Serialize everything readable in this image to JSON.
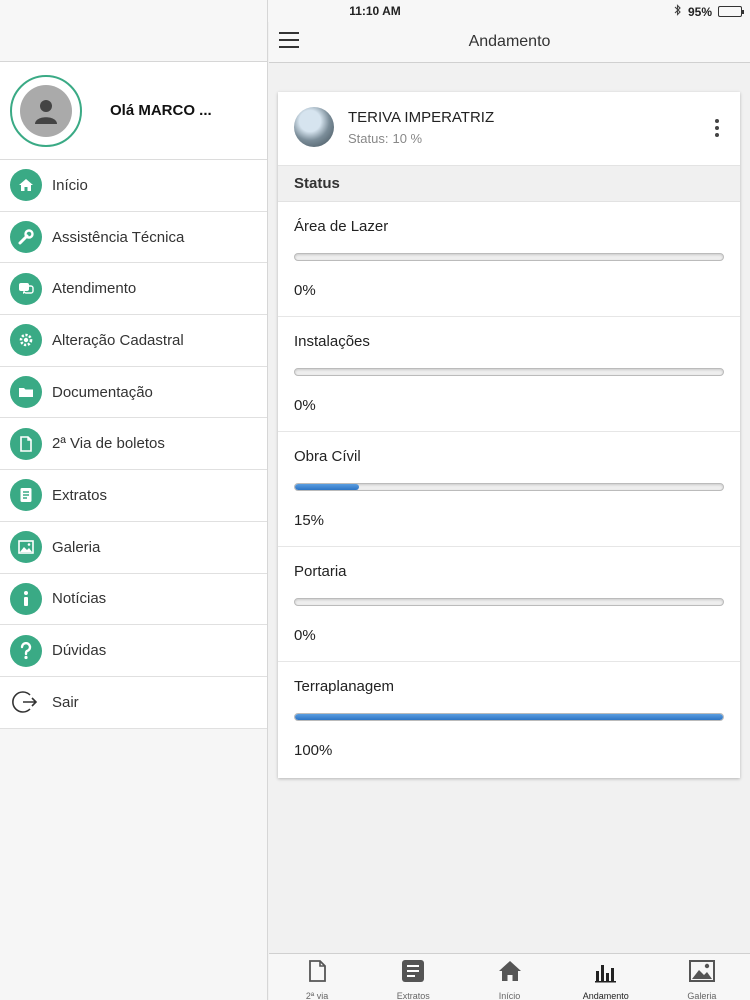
{
  "status_bar": {
    "device": "iPad",
    "time": "11:10 AM",
    "battery": "95%",
    "battery_level": 0.95
  },
  "header": {
    "title": "Andamento"
  },
  "sidebar": {
    "greeting": "Olá MARCO ...",
    "items": [
      {
        "label": "Início",
        "icon": "home-icon"
      },
      {
        "label": "Assistência Técnica",
        "icon": "wrench-icon"
      },
      {
        "label": "Atendimento",
        "icon": "chat-icon"
      },
      {
        "label": "Alteração Cadastral",
        "icon": "gear-icon"
      },
      {
        "label": "Documentação",
        "icon": "folder-icon"
      },
      {
        "label": "2ª Via de boletos",
        "icon": "file-icon"
      },
      {
        "label": "Extratos",
        "icon": "document-list-icon"
      },
      {
        "label": "Galeria",
        "icon": "gallery-icon"
      },
      {
        "label": "Notícias",
        "icon": "info-icon"
      },
      {
        "label": "Dúvidas",
        "icon": "question-icon"
      },
      {
        "label": "Sair",
        "icon": "logout-icon"
      }
    ]
  },
  "project": {
    "name": "TERIVA IMPERATRIZ",
    "status_label": "Status:",
    "status_value": "10 %"
  },
  "section": {
    "title": "Status"
  },
  "stages": [
    {
      "name": "Área de Lazer",
      "percent_label": "0%",
      "progress": 0
    },
    {
      "name": "Instalações",
      "percent_label": "0%",
      "progress": 0
    },
    {
      "name": "Obra Cívil",
      "percent_label": "15%",
      "progress": 0.15
    },
    {
      "name": "Portaria",
      "percent_label": "0%",
      "progress": 0
    },
    {
      "name": "Terraplanagem",
      "percent_label": "100%",
      "progress": 1.0
    }
  ],
  "tabs": [
    {
      "label": "2ª via",
      "icon": "file-icon",
      "active": false
    },
    {
      "label": "Extratos",
      "icon": "document-list-icon",
      "active": false
    },
    {
      "label": "Início",
      "icon": "home-icon",
      "active": false
    },
    {
      "label": "Andamento",
      "icon": "bar-chart-icon",
      "active": true
    },
    {
      "label": "Galeria",
      "icon": "gallery-icon",
      "active": false
    }
  ],
  "colors": {
    "accent": "#3aaa85",
    "progress": "#2d74c4"
  }
}
